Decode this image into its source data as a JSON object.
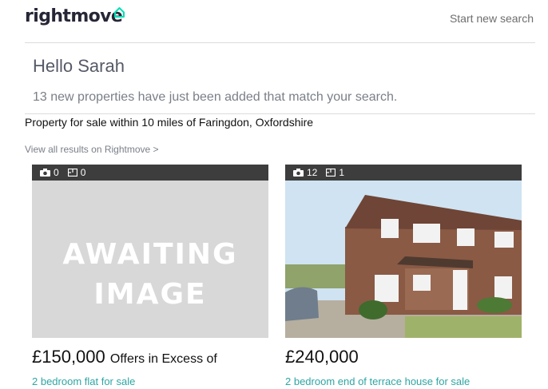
{
  "header": {
    "logo_text": "rightmove",
    "logo_icon": "house-icon",
    "start_new_search": "Start new search"
  },
  "greeting": {
    "hello": "Hello Sarah",
    "intro": "13 new properties have just been added that match your search."
  },
  "search": {
    "criteria": "Property for sale within 10 miles of Faringdon, Oxfordshire",
    "view_all": "View all results on Rightmove >"
  },
  "listings": [
    {
      "photo_count": "0",
      "floorplan_count": "0",
      "image": "awaiting-image",
      "placeholder_line1": "AWAITING",
      "placeholder_line2": "IMAGE",
      "price": "£150,000",
      "price_qualifier": "Offers in Excess of",
      "type": "2 bedroom flat for sale"
    },
    {
      "photo_count": "12",
      "floorplan_count": "1",
      "image": "house-photo",
      "price": "£240,000",
      "price_qualifier": "",
      "type": "2 bedroom end of terrace house for sale"
    }
  ],
  "colors": {
    "brand_text": "#262637",
    "brand_accent": "#00deb6",
    "link_teal": "#2ea6a4",
    "card_bar": "#3d3d3d"
  }
}
